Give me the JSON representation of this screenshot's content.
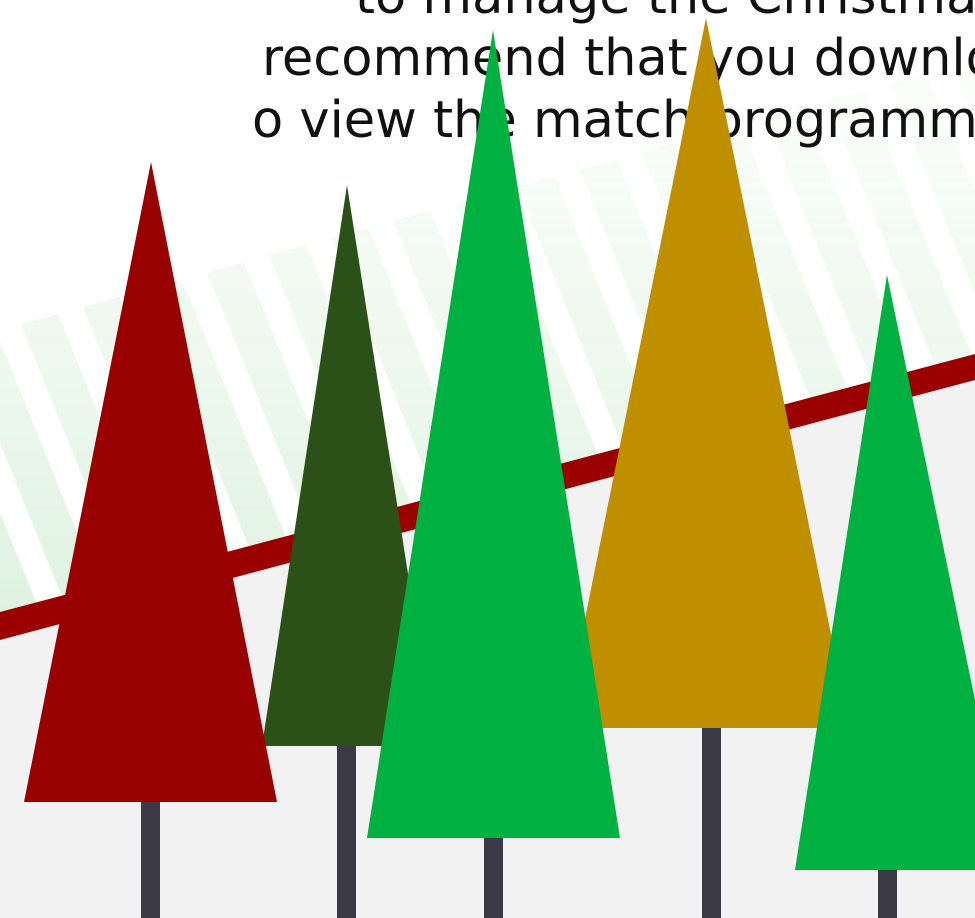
{
  "intro": {
    "line_1": "to manage the Christmas Cup",
    "line_2": "recommend that you download",
    "line_3": "o view the match programme and"
  },
  "colors": {
    "background_floor": "#f2f2f2",
    "ribbon": "#9b0000",
    "stripe_green": "#5cbf62",
    "trunk": "#3a3945",
    "tree_red": "#990000",
    "tree_dark_green": "#2c5118",
    "tree_bright_green": "#00b040",
    "tree_gold": "#bf8f00"
  }
}
